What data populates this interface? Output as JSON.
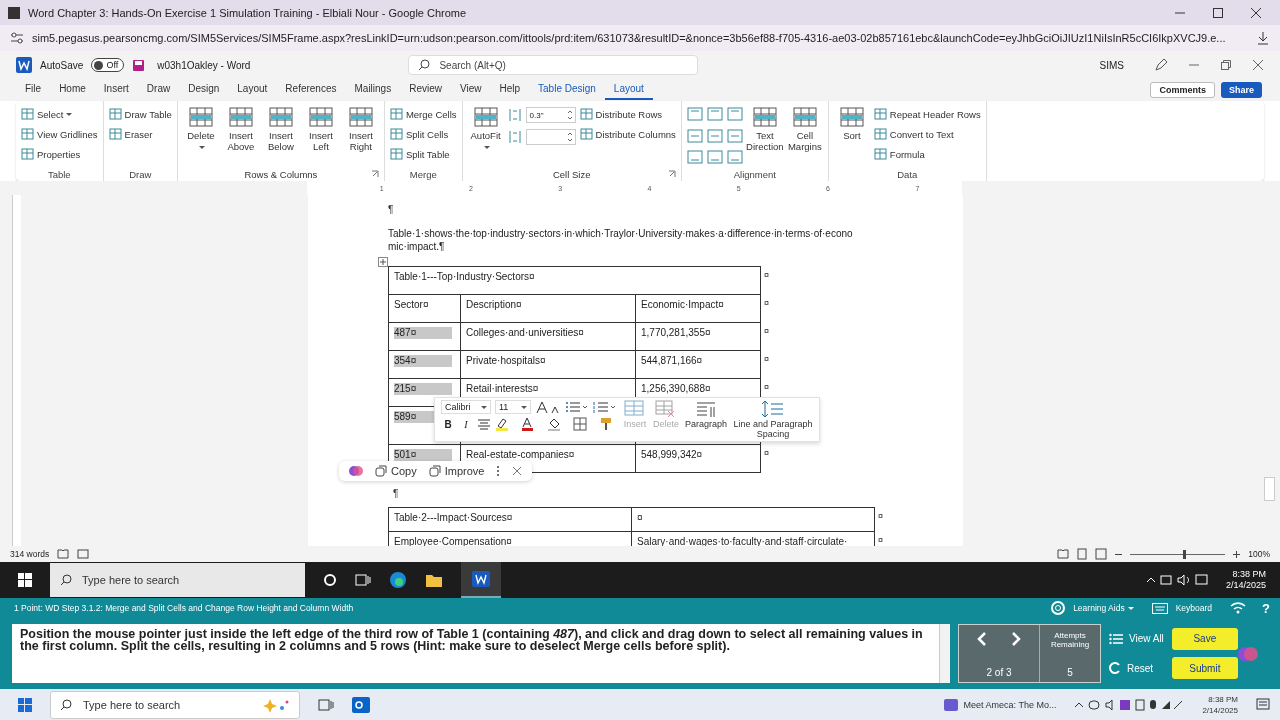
{
  "browser": {
    "title": "Word Chapter 3: Hands-On Exercise 1 Simulation Training - Elbiali Nour - Google Chrome",
    "url": "sim5.pegasus.pearsoncmg.com/SIM5Services/SIM5Frame.aspx?resLinkID=urn:udson:pearson.com/ittools/prd:item/631073&resultID=&nonce=3b56ef88-f705-4316-ae03-02b857161ebc&launchCode=eyJhbGciOiJIUzI1NiIsInR5cCI6IkpXVCJ9.e..."
  },
  "word": {
    "autosave": "AutoSave",
    "autosave_on": false,
    "autosave_state": "Off",
    "doc_title": "w03h1Oakley - Word",
    "search_placeholder": "Search (Alt+Q)",
    "user": "SIMS",
    "comments": "Comments",
    "share": "Share"
  },
  "tabs": [
    {
      "label": "File",
      "selected": false
    },
    {
      "label": "Home",
      "selected": false
    },
    {
      "label": "Insert",
      "selected": false
    },
    {
      "label": "Draw",
      "selected": false
    },
    {
      "label": "Design",
      "selected": false
    },
    {
      "label": "Layout",
      "selected": false
    },
    {
      "label": "References",
      "selected": false
    },
    {
      "label": "Mailings",
      "selected": false
    },
    {
      "label": "Review",
      "selected": false
    },
    {
      "label": "View",
      "selected": false
    },
    {
      "label": "Help",
      "selected": false
    },
    {
      "label": "Table Design",
      "selected": false
    },
    {
      "label": "Layout",
      "selected": true
    }
  ],
  "ribbon_groups": [
    {
      "name": "Table",
      "launcher": false,
      "items": [
        {
          "kind": "stack",
          "items": [
            {
              "kind": "small",
              "label": "Select",
              "caret": true
            },
            {
              "kind": "small",
              "label": "View Gridlines",
              "caret": false
            },
            {
              "kind": "small",
              "label": "Properties",
              "caret": false
            }
          ]
        }
      ]
    },
    {
      "name": "Draw",
      "launcher": false,
      "items": [
        {
          "kind": "stack",
          "items": [
            {
              "kind": "small",
              "label": "Draw Table",
              "caret": false
            },
            {
              "kind": "small",
              "label": "Eraser",
              "caret": false
            }
          ]
        }
      ]
    },
    {
      "name": "Rows & Columns",
      "launcher": true,
      "items": [
        {
          "kind": "large",
          "label": "Delete",
          "caret": true
        },
        {
          "kind": "large",
          "label": "Insert Above",
          "caret": false
        },
        {
          "kind": "large",
          "label": "Insert Below",
          "caret": false
        },
        {
          "kind": "large",
          "label": "Insert Left",
          "caret": false
        },
        {
          "kind": "large",
          "label": "Insert Right",
          "caret": false
        }
      ]
    },
    {
      "name": "Merge",
      "launcher": false,
      "items": [
        {
          "kind": "stack",
          "items": [
            {
              "kind": "small",
              "label": "Merge Cells",
              "caret": false
            },
            {
              "kind": "small",
              "label": "Split Cells",
              "caret": false
            },
            {
              "kind": "small",
              "label": "Split Table",
              "caret": false
            }
          ]
        }
      ]
    },
    {
      "name": "Cell Size",
      "launcher": true,
      "items": [
        {
          "kind": "large",
          "label": "AutoFit",
          "caret": true
        },
        {
          "kind": "stack",
          "items": [
            {
              "kind": "spin",
              "value": "0.3\""
            },
            {
              "kind": "spin"
            }
          ]
        },
        {
          "kind": "stack",
          "items": [
            {
              "kind": "small",
              "label": "Distribute Rows",
              "caret": false
            },
            {
              "kind": "small",
              "label": "Distribute Columns",
              "caret": false
            }
          ]
        }
      ]
    },
    {
      "name": "Alignment",
      "launcher": false,
      "items": [
        {
          "kind": "aligngrid"
        },
        {
          "kind": "large",
          "label": "Text Direction",
          "caret": false
        },
        {
          "kind": "large",
          "label": "Cell Margins",
          "caret": false
        }
      ]
    },
    {
      "name": "Data",
      "launcher": false,
      "items": [
        {
          "kind": "large",
          "label": "Sort",
          "caret": false
        },
        {
          "kind": "stack",
          "items": [
            {
              "kind": "small",
              "label": "Repeat Header Rows",
              "caret": false
            },
            {
              "kind": "small",
              "label": "Convert to Text",
              "caret": false
            },
            {
              "kind": "small",
              "label": "Formula",
              "caret": false
            }
          ]
        }
      ]
    }
  ],
  "ruler": [
    "1",
    "2",
    "3",
    "4",
    "5",
    "6",
    "7"
  ],
  "document": {
    "top_mark": "¶",
    "paragraph": "Table·1·shows·the·top·industry·sectors·in·which·Traylor·University·makes·a·difference·in·terms·of·economic·impact.¶",
    "table1": {
      "caption": "Table·1---Top·Industry·Sectors¤",
      "headers": [
        "Sector¤",
        "Description¤",
        "Economic·Impact¤"
      ],
      "end": "¤",
      "rows": [
        {
          "cells": [
            "487¤",
            "Colleges·and·universities¤",
            "1,770,281,355¤"
          ],
          "selected": true
        },
        {
          "cells": [
            "354¤",
            "Private·hospitals¤",
            "544,871,166¤"
          ],
          "selected": true
        },
        {
          "cells": [
            "215¤",
            "Retail·interests¤",
            "1,256,390,688¤"
          ],
          "selected": true
        },
        {
          "cells": [
            "589¤"
          ],
          "selected": true
        },
        {
          "cells": [
            "501¤",
            "Real-estate-companies¤",
            "548,999,342¤"
          ],
          "selected": true
        }
      ]
    },
    "after_mark": "¶",
    "table2": {
      "end": "¤",
      "rows": [
        [
          "Table·2---Impact·Sources¤",
          "¤"
        ],
        [
          "Employee·Compensation¤",
          "Salary·and·wages·to·faculty·and·staff·circulate·"
        ]
      ]
    }
  },
  "mini_toolbar": {
    "font": "Calibri",
    "size": "11",
    "bold": "B",
    "italic": "I",
    "actions": [
      {
        "kind": "insert",
        "label": "Insert",
        "disabled": true
      },
      {
        "kind": "delete",
        "label": "Delete",
        "disabled": true
      },
      {
        "kind": "paragraph",
        "label": "Paragraph",
        "disabled": false
      },
      {
        "kind": "spacing",
        "label": "Line and Paragraph Spacing",
        "disabled": false
      }
    ]
  },
  "copilot": {
    "actions": [
      "Copy",
      "Improve"
    ]
  },
  "status": {
    "words": "314 words",
    "zoom": "100%",
    "level": 0.55
  },
  "taskbar_inner": {
    "search_placeholder": "Type here to search",
    "time": "8:38 PM",
    "date": "2/14/2025"
  },
  "sim": {
    "step": "1 Point: WD Step 3.1.2: Merge and Split Cells and Change Row Height and Column Width",
    "learning_aids": "Learning Aids",
    "keyboard": "Keyboard",
    "help": "?",
    "instruction": "Position the mouse pointer just inside the left edge of the third row of Table 1 (containing *487*), and click and drag down to select all remaining values in the first column. Split the cells, resulting in 2 columns and 5 rows (Hint: make sure to deselect Merge cells before split).",
    "page": "2 of 3",
    "attempts_label": "Attempts Remaining",
    "attempts": "5",
    "view_all": "View All",
    "reset": "Reset",
    "save": "Save",
    "submit": "Submit"
  },
  "taskbar_outer": {
    "search_placeholder": "Type here to search",
    "window": "Meet Ameca: The Mo...",
    "time": "8:38 PM",
    "date": "2/14/2025"
  }
}
